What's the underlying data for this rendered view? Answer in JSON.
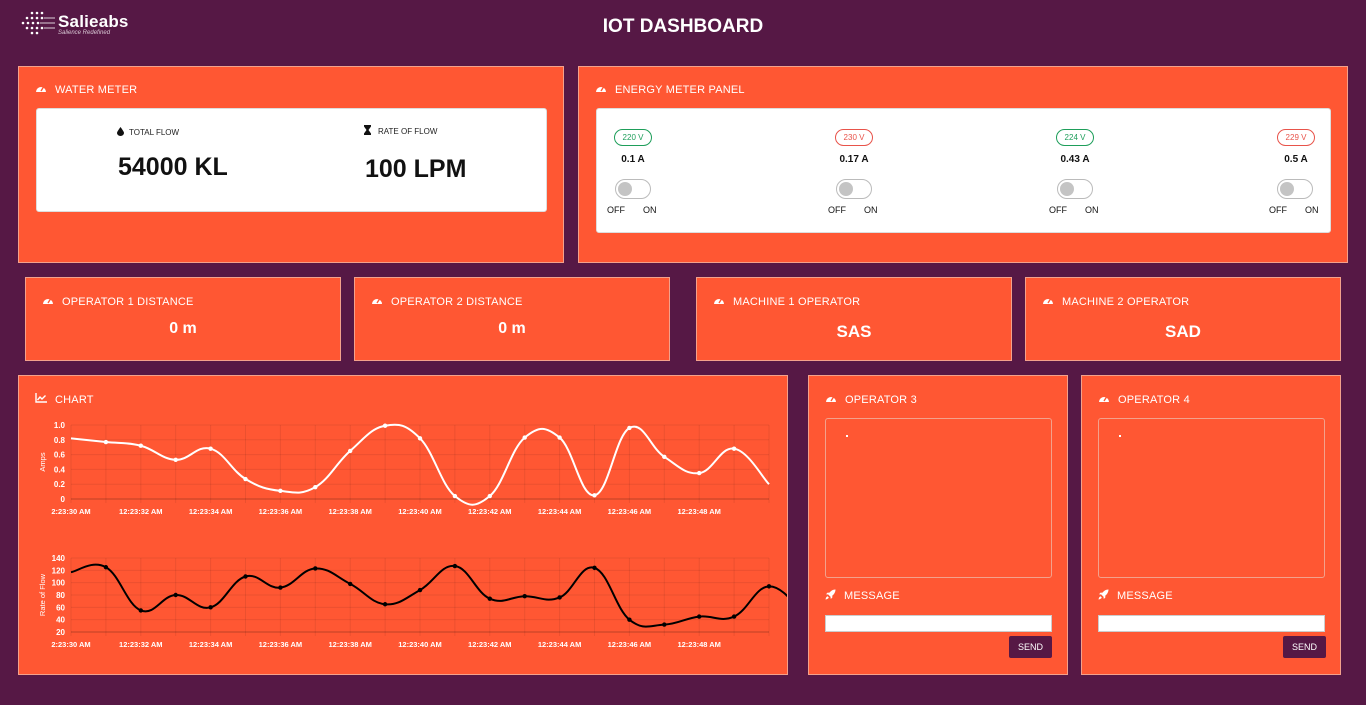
{
  "brand": {
    "name": "Salieabs",
    "tagline": "Salience Redefined"
  },
  "page_title": "IOT DASHBOARD",
  "water_meter": {
    "title": "WATER METER",
    "total_flow_label": "TOTAL FLOW",
    "total_flow_value": "54000 KL",
    "rate_label": "RATE OF FLOW",
    "rate_value": "100 LPM"
  },
  "energy_meter": {
    "title": "ENERGY METER PANEL",
    "off_label": "OFF",
    "on_label": "ON",
    "channels": [
      {
        "voltage": "220 V",
        "current": "0.1 A",
        "status_color": "#1e9e5a",
        "toggle_on": false
      },
      {
        "voltage": "230 V",
        "current": "0.17 A",
        "status_color": "#e8534a",
        "toggle_on": false
      },
      {
        "voltage": "224 V",
        "current": "0.43 A",
        "status_color": "#1e9e5a",
        "toggle_on": false
      },
      {
        "voltage": "229 V",
        "current": "0.5 A",
        "status_color": "#e8534a",
        "toggle_on": false
      }
    ]
  },
  "cards": [
    {
      "title": "OPERATOR 1 DISTANCE",
      "value": "0 m"
    },
    {
      "title": "OPERATOR 2 DISTANCE",
      "value": "0 m"
    },
    {
      "title": "MACHINE 1 OPERATOR",
      "value": "SAS"
    },
    {
      "title": "MACHINE 2 OPERATOR",
      "value": "SAD"
    }
  ],
  "chart_panel": {
    "title": "CHART"
  },
  "operators": [
    {
      "title": "OPERATOR 3",
      "message_label": "MESSAGE",
      "send_label": "SEND",
      "message_value": ""
    },
    {
      "title": "OPERATOR 4",
      "message_label": "MESSAGE",
      "send_label": "SEND",
      "message_value": ""
    }
  ],
  "colors": {
    "background": "#561845",
    "panel": "#ff5733",
    "accent": "#561845"
  },
  "chart_data": [
    {
      "type": "line",
      "ylabel": "Amps",
      "ylim": [
        0,
        1.0
      ],
      "yticks": [
        "0",
        "0.2",
        "0.4",
        "0.6",
        "0.8",
        "1.0"
      ],
      "xtick_labels": [
        "2:23:30 AM",
        "12:23:32 AM",
        "12:23:34 AM",
        "12:23:36 AM",
        "12:23:38 AM",
        "12:23:40 AM",
        "12:23:42 AM",
        "12:23:44 AM",
        "12:23:46 AM",
        "12:23:48 AM"
      ],
      "x": [
        0,
        1,
        2,
        3,
        4,
        5,
        6,
        7,
        8,
        9,
        10,
        11,
        12,
        13,
        14,
        15,
        16,
        17,
        18,
        19,
        20
      ],
      "values": [
        0.82,
        0.77,
        0.72,
        0.53,
        0.68,
        0.27,
        0.11,
        0.16,
        0.65,
        0.99,
        0.82,
        0.04,
        0.04,
        0.83,
        0.83,
        0.05,
        0.96,
        0.57,
        0.35,
        0.68,
        0.2
      ],
      "line_color": "#ffffff",
      "grid": true
    },
    {
      "type": "line",
      "ylabel": "Rate of Flow",
      "ylim": [
        20,
        140
      ],
      "yticks": [
        "20",
        "40",
        "60",
        "80",
        "100",
        "120",
        "140"
      ],
      "xtick_labels": [
        "2:23:30 AM",
        "12:23:32 AM",
        "12:23:34 AM",
        "12:23:36 AM",
        "12:23:38 AM",
        "12:23:40 AM",
        "12:23:42 AM",
        "12:23:44 AM",
        "12:23:46 AM",
        "12:23:48 AM"
      ],
      "x": [
        0,
        1,
        2,
        3,
        4,
        5,
        6,
        7,
        8,
        9,
        10,
        11,
        12,
        13,
        14,
        15,
        16,
        17,
        18,
        19,
        20
      ],
      "values": [
        117,
        125,
        55,
        80,
        60,
        110,
        92,
        123,
        98,
        65,
        88,
        127,
        74,
        78,
        76,
        124,
        40,
        32,
        45,
        45,
        94,
        50
      ],
      "line_color": "#000000",
      "grid": true
    }
  ]
}
